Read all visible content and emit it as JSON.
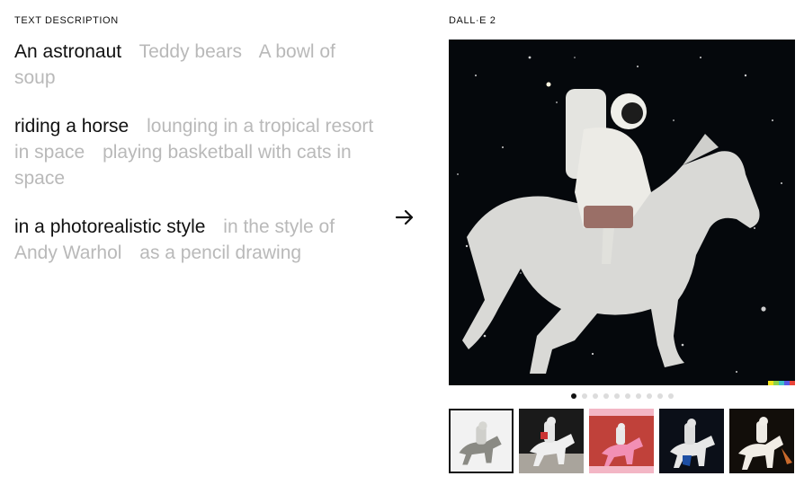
{
  "left": {
    "label": "TEXT DESCRIPTION",
    "groups": [
      {
        "options": [
          "An astronaut",
          "Teddy bears",
          "A bowl of soup"
        ],
        "selected": 0
      },
      {
        "options": [
          "riding a horse",
          "lounging in a tropical resort in space",
          "playing basketball with cats in space"
        ],
        "selected": 0
      },
      {
        "options": [
          "in a photorealistic style",
          "in the style of Andy Warhol",
          "as a pencil drawing"
        ],
        "selected": 0
      }
    ]
  },
  "right": {
    "label": "DALL·E 2",
    "main_image": {
      "alt": "An astronaut riding a horse in a photorealistic style"
    },
    "pagination": {
      "count": 10,
      "active": 0
    },
    "thumbnails": [
      {
        "bg": "#f2f2f2",
        "selected": true
      },
      {
        "bg": "#1a1a1a",
        "selected": false
      },
      {
        "bg": "#c0413a",
        "selected": false
      },
      {
        "bg": "#0b0f18",
        "selected": false
      },
      {
        "bg": "#120e0a",
        "selected": false
      }
    ],
    "color_strip": [
      "#f5e51b",
      "#8ed34b",
      "#3fc1c9",
      "#5a5ae6",
      "#e9453b"
    ]
  },
  "icons": {
    "next": "arrow-right-icon"
  }
}
